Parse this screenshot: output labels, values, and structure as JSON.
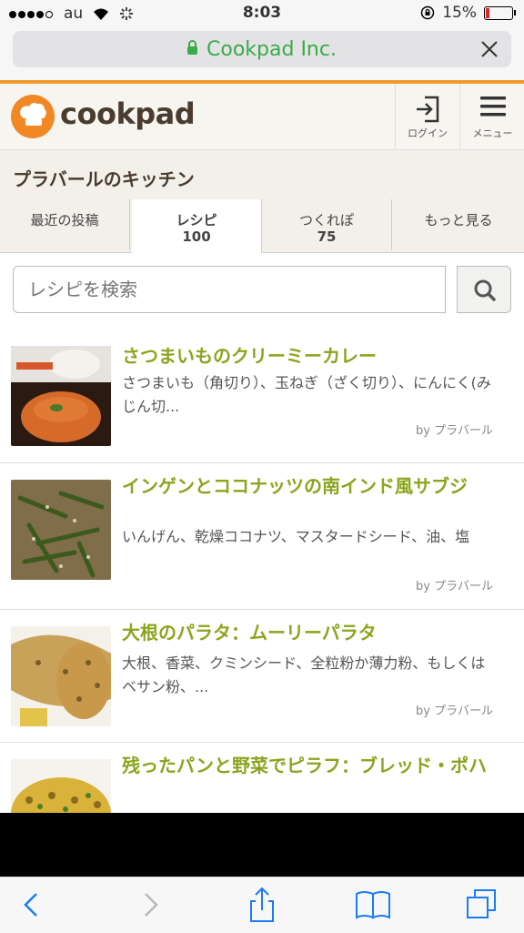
{
  "status_bar": {
    "carrier": "au",
    "time": "8:03",
    "battery": "15%"
  },
  "url_bar": {
    "site": "Cookpad Inc."
  },
  "header": {
    "logo": "cookpad",
    "login_label": "ログイン",
    "menu_label": "メニュー"
  },
  "kitchen_title": "プラバールのキッチン",
  "tabs": [
    {
      "label": "最近の投稿",
      "count": ""
    },
    {
      "label": "レシピ",
      "count": "100"
    },
    {
      "label": "つくれぽ",
      "count": "75"
    },
    {
      "label": "もっと見る",
      "count": ""
    }
  ],
  "search": {
    "placeholder": "レシピを検索"
  },
  "recipes": [
    {
      "title": "さつまいものクリーミーカレー",
      "desc": "さつまいも（角切り）、玉ねぎ（ざく切り）、にんにく(みじん切...",
      "by": "by プラバール"
    },
    {
      "title": "インゲンとココナッツの南インド風サブジ",
      "desc": "いんげん、乾燥ココナツ、マスタードシード、油、塩",
      "by": "by プラバール"
    },
    {
      "title": "大根のパラタ：ムーリーパラタ",
      "desc": "大根、香菜、クミンシード、全粒粉か薄力粉、もしくはベサン粉、...",
      "by": "by プラバール"
    },
    {
      "title": "残ったパンと野菜でピラフ：ブレッド・ポハ",
      "desc": "",
      "by": ""
    }
  ],
  "colors": {
    "accent_orange": "#f39a2c",
    "title_green": "#8aa51c",
    "url_green": "#3aaa4a",
    "ios_blue": "#1a7cf5"
  }
}
